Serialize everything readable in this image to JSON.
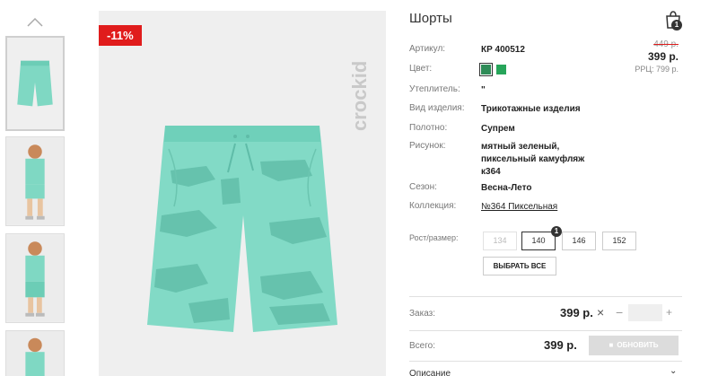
{
  "product": {
    "title": "Шорты",
    "discount_badge": "-11%",
    "brand": "crockid",
    "old_price": "449 р.",
    "price": "399 р.",
    "rrp": "РРЦ: 799 р."
  },
  "cart": {
    "count": "1"
  },
  "attributes": {
    "article": {
      "label": "Артикул:",
      "value": "КР 400512"
    },
    "color": {
      "label": "Цвет:",
      "swatches": [
        "#2e8b57",
        "#27a55a"
      ]
    },
    "insulation": {
      "label": "Утеплитель:",
      "value": "\""
    },
    "type": {
      "label": "Вид изделия:",
      "value": "Трикотажные изделия"
    },
    "fabric": {
      "label": "Полотно:",
      "value": "Супрем"
    },
    "pattern": {
      "label": "Рисунок:",
      "value_lines": [
        "мятный зеленый,",
        "пиксельный камуфляж",
        "к364"
      ]
    },
    "season": {
      "label": "Сезон:",
      "value": "Весна-Лето"
    },
    "collection": {
      "label": "Коллекция:",
      "value": "№364 Пиксельная"
    }
  },
  "sizes": {
    "label": "Рост/размер:",
    "options": [
      {
        "label": "134",
        "state": "disabled"
      },
      {
        "label": "140",
        "state": "selected",
        "badge": "1"
      },
      {
        "label": "146",
        "state": "normal"
      },
      {
        "label": "152",
        "state": "normal"
      }
    ],
    "select_all": "ВЫБРАТЬ ВСЕ"
  },
  "order": {
    "label": "Заказ:",
    "price": "399 р.",
    "remove_symbol": "×",
    "minus": "−",
    "plus": "+",
    "qty_value": ""
  },
  "total": {
    "label": "Всего:",
    "price": "399 р.",
    "update_button": "ОБНОВИТЬ"
  },
  "description": {
    "label": "Описание"
  },
  "colors": {
    "accent_red": "#e01c1c",
    "mint": "#7fd8c3",
    "mint_dark": "#5cbfa9"
  },
  "icons": {
    "thumb_up": "chevron-up-icon",
    "cart": "shopping-bag-icon",
    "update": "cart-icon",
    "description": "chevron-down-icon"
  }
}
